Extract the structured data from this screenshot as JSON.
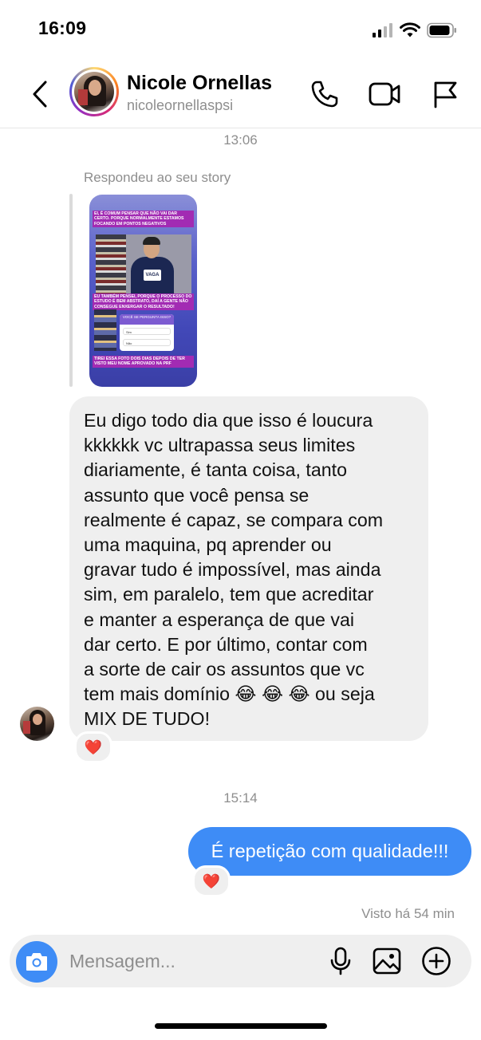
{
  "status_bar": {
    "time": "16:09"
  },
  "header": {
    "name": "Nicole Ornellas",
    "handle": "nicoleornellaspsi",
    "icons": [
      "back-chevron-icon",
      "phone-icon",
      "video-camera-icon",
      "flag-icon"
    ]
  },
  "conversation": {
    "timestamp_1": "13:06",
    "reply_note": "Respondeu ao seu story",
    "story": {
      "caption_1": "EI, É COMUM PENSAR QUE NÃO VAI DAR CERTO. PORQUE NORMALMENTE ESTAMOS FOCANDO EM PONTOS NEGATIVOS",
      "caption_2": "EU TAMBÉM PENSEI, PORQUE O PROCESSO DO ESTUDO É BEM ABSTRATO, DAÍ A GENTE NÃO CONSEGUE ENXERGAR O RESULTADO!",
      "poll_question": "VOCÊ SE PERGUNTA ISSO?",
      "poll_option_1": "Sim",
      "poll_option_2": "Não",
      "caption_3": "TIREI ESSA FOTO DOIS DIAS DEPOIS DE TER VISTO MEU NOME APROVADO NA PRF",
      "shirt_text": "VAGA"
    },
    "incoming_message": "Eu digo todo dia que isso é loucura\nkkkkkk vc ultrapassa seus limites\ndiariamente, é tanta coisa, tanto\nassunto que você pensa se\nrealmente é capaz, se compara com\numa maquina, pq aprender ou\ngravar tudo é impossível, mas ainda\nsim, em paralelo, tem que acreditar\ne manter a esperança de que vai\ndar certo. E por último, contar com\na sorte de cair os assuntos que vc\ntem mais domínio 😂 😂 😂  ou seja\nMIX DE TUDO!",
    "incoming_reaction": "❤️",
    "timestamp_2": "15:14",
    "outgoing_message": "É repetição com qualidade!!!",
    "outgoing_reaction": "❤️",
    "seen_status": "Visto há 54 min"
  },
  "composer": {
    "placeholder": "Mensagem...",
    "icons": [
      "camera-icon",
      "microphone-icon",
      "gallery-icon",
      "plus-circle-icon"
    ],
    "accent_color": "#3e8cf6"
  },
  "colors": {
    "outgoing_bubble": "#3e8cf6",
    "incoming_bubble": "#efefef",
    "secondary_text": "#8e8e8e"
  }
}
